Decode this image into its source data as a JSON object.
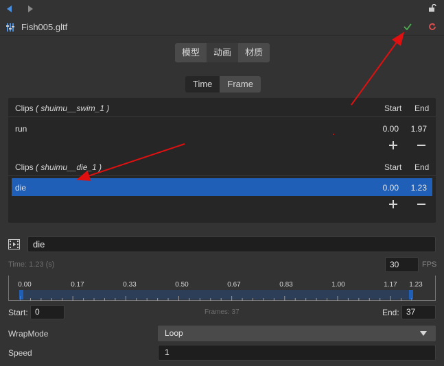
{
  "window": {
    "file_title": "Fish005.gltf"
  },
  "tabs": [
    {
      "label": "模型"
    },
    {
      "label": "动画"
    },
    {
      "label": "材质"
    }
  ],
  "time_mode": {
    "options": [
      "Time",
      "Frame"
    ],
    "selected": "Frame"
  },
  "clip_groups": [
    {
      "header_label": "Clips",
      "source": "( shuimu__swim_1 )",
      "start_header": "Start",
      "end_header": "End",
      "clips": [
        {
          "name": "run",
          "start": "0.00",
          "end": "1.97"
        }
      ]
    },
    {
      "header_label": "Clips",
      "source": "( shuimu__die_1 )",
      "start_header": "Start",
      "end_header": "End",
      "clips": [
        {
          "name": "die",
          "start": "0.00",
          "end": "1.23"
        }
      ]
    }
  ],
  "editor": {
    "clip_name": "die",
    "time_label": "Time: 1.23 (s)",
    "fps_value": "30",
    "fps_label": "FPS",
    "timeline_ticks": [
      "0.00",
      "0.17",
      "0.33",
      "0.50",
      "0.67",
      "0.83",
      "1.00",
      "1.17",
      "1.23"
    ],
    "start_label": "Start:",
    "start_value": "0",
    "frames_label": "Frames: 37",
    "end_label": "End:",
    "end_value": "37",
    "wrapmode_label": "WrapMode",
    "wrapmode_value": "Loop",
    "speed_label": "Speed",
    "speed_value": "1"
  },
  "colors": {
    "selection": "#1f5fb8",
    "apply_check": "#4caf50",
    "revert": "#e05050",
    "annotation_arrow": "#e01010"
  }
}
